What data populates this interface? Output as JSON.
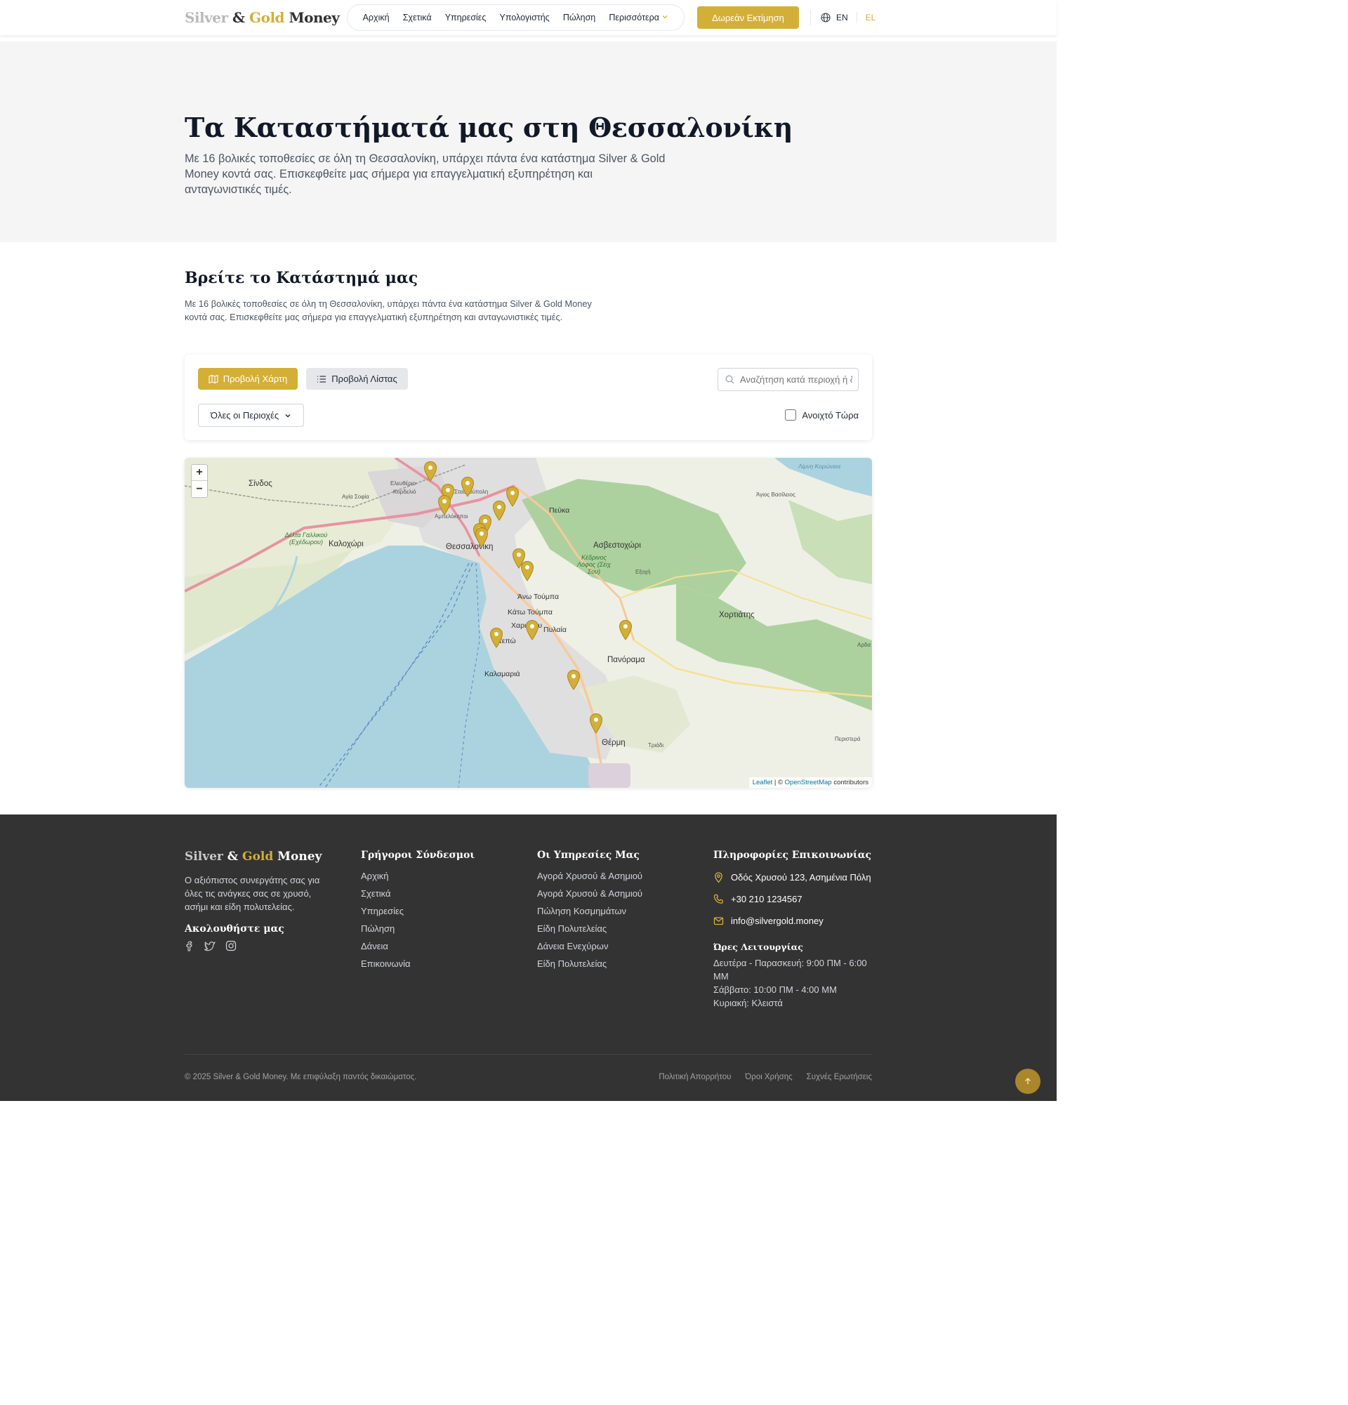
{
  "header": {
    "logo": {
      "silver": "Silver",
      "amp": "&",
      "gold": "Gold",
      "money": "Money"
    },
    "nav": [
      "Αρχική",
      "Σχετικά",
      "Υπηρεσίες",
      "Υπολογιστής",
      "Πώληση"
    ],
    "more_label": "Περισσότερα",
    "cta_label": "Δωρεάν Εκτίμηση",
    "lang_en": "EN",
    "lang_el": "EL"
  },
  "hero": {
    "title": "Τα Καταστήματά μας στη Θεσσαλονίκη",
    "subtitle": "Με 16 βολικές τοποθεσίες σε όλη τη Θεσσαλονίκη, υπάρχει πάντα ένα κατάστημα Silver & Gold Money κοντά σας. Επισκεφθείτε μας σήμερα για επαγγελματική εξυπηρέτηση και ανταγωνιστικές τιμές."
  },
  "finder": {
    "title": "Βρείτε το Κατάστημά μας",
    "description": "Με 16 βολικές τοποθεσίες σε όλη τη Θεσσαλονίκη, υπάρχει πάντα ένα κατάστημα Silver & Gold Money κοντά σας. Επισκεφθείτε μας σήμερα για επαγγελματική εξυπηρέτηση και ανταγωνιστικές τιμές.",
    "map_view_label": "Προβολή Χάρτη",
    "list_view_label": "Προβολή Λίστας",
    "search_placeholder": "Αναζήτηση κατά περιοχή ή διεύθυνση",
    "region_label": "Όλες οι Περιοχές",
    "open_now_label": "Ανοιχτό Τώρα"
  },
  "map": {
    "zoom_in": "+",
    "zoom_out": "−",
    "attribution": {
      "leaflet": "Leaflet",
      "sep": " | © ",
      "osm": "OpenStreetMap",
      "contributors": " contributors"
    },
    "labels": {
      "sindos": "Σίνδος",
      "eleftherio": "Ελευθέριο-",
      "kordelio": "Κορδελιό",
      "agia_sofia": "Αγία Σοφία",
      "kalochori": "Καλοχώρι",
      "thessaloniki": "Θεσσαλονίκη",
      "stavroupoli": "Σταυρούπολη",
      "ampelokipoi": "Αμπελόκηποι",
      "pefka": "Πεύκα",
      "asvestochori": "Ασβεστοχώρι",
      "exochi": "Εξοχή",
      "ano_toumpa": "Άνω Τούμπα",
      "kato_toumpa": "Κάτω Τούμπα",
      "charilaou": "Χαριλάου",
      "pylaia": "Πυλαία",
      "ntepo": "Ντεπώ",
      "kalamaria": "Καλαμαριά",
      "panorama": "Πανόραμα",
      "chortiatis": "Χορτιάτης",
      "thermi": "Θέρμη",
      "triadi": "Τριάδι",
      "peristera": "Περιστερά",
      "agios_vasileios": "Άγιος Βασίλειος",
      "limni_koroneia": "Λίμνη Κορώνεια",
      "kedrinos_lofos": "Κέδρινος Λόφος (Σέιχ Σου)",
      "delta_gallikou": "Δέλτα Γαλλικού (Εχέδωρου)",
      "arda": "Αρδα"
    },
    "store_count": 16
  },
  "footer": {
    "logo": {
      "silver": "Silver",
      "amp": "&",
      "gold": "Gold",
      "money": "Money"
    },
    "about": "Ο αξιόπιστος συνεργάτης σας για όλες τις ανάγκες σας σε χρυσό, ασήμι και είδη πολυτελείας.",
    "follow_title": "Ακολουθήστε μας",
    "quick_title": "Γρήγοροι Σύνδεσμοι",
    "quick_links": [
      "Αρχική",
      "Σχετικά",
      "Υπηρεσίες",
      "Πώληση",
      "Δάνεια",
      "Επικοινωνία"
    ],
    "services_title": "Οι Υπηρεσίες Μας",
    "services": [
      "Αγορά Χρυσού & Ασημιού",
      "Αγορά Χρυσού & Ασημιού",
      "Πώληση Κοσμημάτων",
      "Είδη Πολυτελείας",
      "Δάνεια Ενεχύρων",
      "Είδη Πολυτελείας"
    ],
    "contact_title": "Πληροφορίες Επικοινωνίας",
    "address": "Οδός Χρυσού 123, Ασημένια Πόλη",
    "phone": "+30 210 1234567",
    "email": "info@silvergold.money",
    "hours_title": "Ώρες Λειτουργίας",
    "hours": [
      "Δευτέρα - Παρασκευή: 9:00 ΠΜ - 6:00 ΜΜ",
      "Σάββατο: 10:00 ΠΜ - 4:00 ΜΜ",
      "Κυριακή: Κλειστά"
    ],
    "copyright": "© 2025 Silver & Gold Money. Με επιφύλαξη παντός δικαιώματος.",
    "legal": [
      "Πολιτική Απορρήτου",
      "Όροι Χρήσης",
      "Συχνές Ερωτήσεις"
    ]
  },
  "colors": {
    "accent": "#d4af37",
    "footer_bg": "#333333",
    "hero_bg": "#f5f5f5",
    "sea": "#aad3df",
    "forest": "#add19e"
  }
}
